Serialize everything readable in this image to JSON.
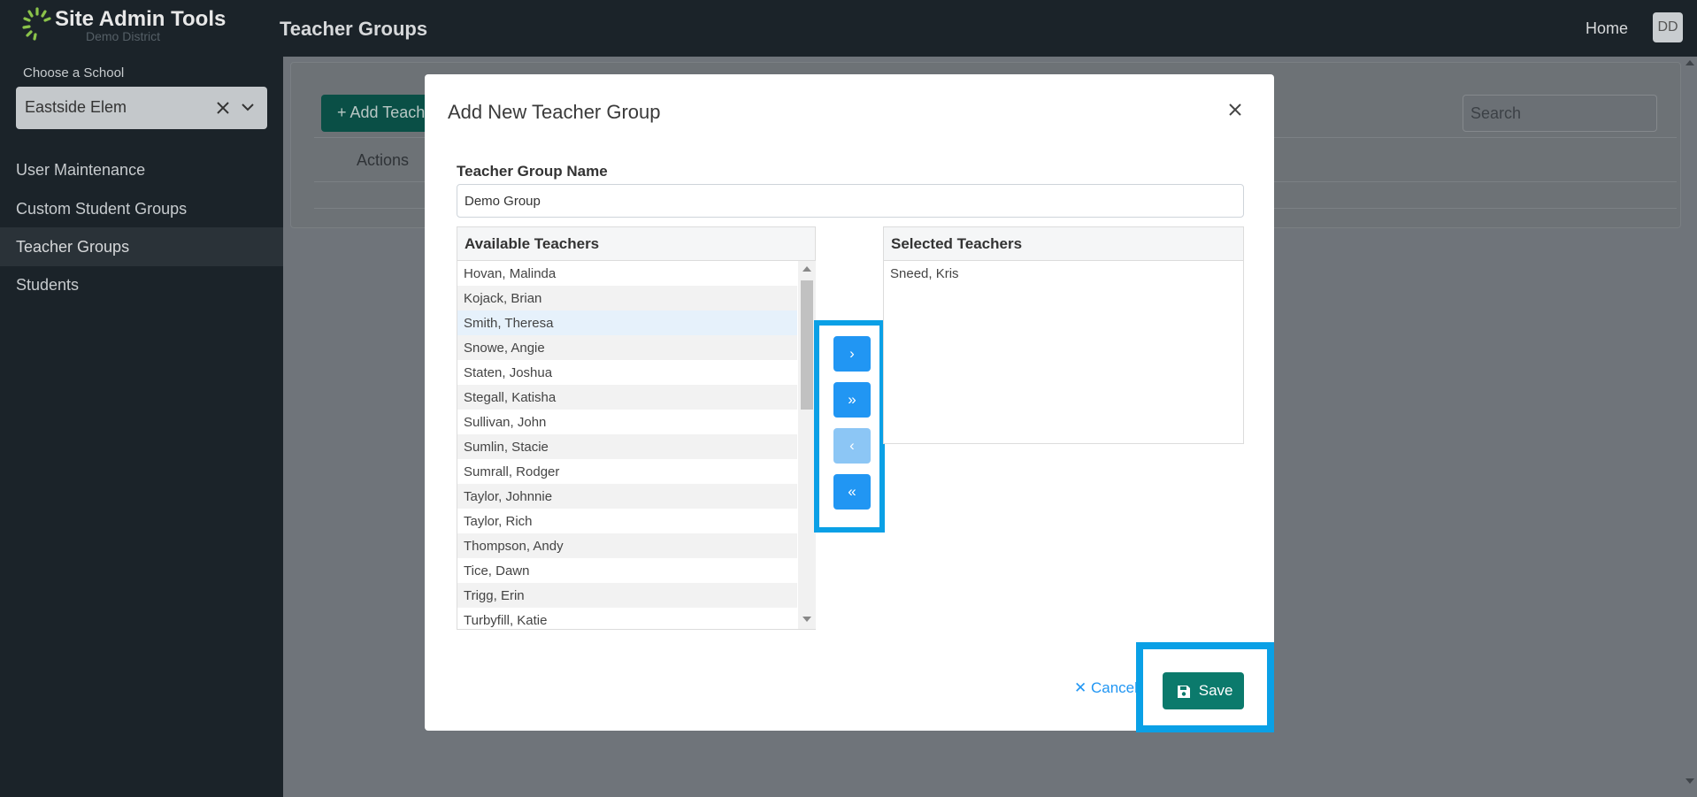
{
  "app": {
    "title": "Site Admin Tools",
    "subtitle": "Demo District"
  },
  "header": {
    "page_title": "Teacher Groups",
    "home_link": "Home",
    "avatar_initials": "DD"
  },
  "sidebar": {
    "school_label": "Choose a School",
    "school_value": "Eastside Elem",
    "items": [
      {
        "label": "User Maintenance",
        "active": false
      },
      {
        "label": "Custom Student Groups",
        "active": false
      },
      {
        "label": "Teacher Groups",
        "active": true
      },
      {
        "label": "Students",
        "active": false
      }
    ]
  },
  "background_page": {
    "add_button_label": "+ Add Teache",
    "search_placeholder": "Search",
    "actions_header": "Actions"
  },
  "modal": {
    "title": "Add New Teacher Group",
    "group_name_label": "Teacher Group Name",
    "group_name_value": "Demo Group",
    "available_header": "Available Teachers",
    "available_teachers": [
      "Hovan, Malinda",
      "Kojack, Brian",
      "Smith, Theresa",
      "Snowe, Angie",
      "Staten, Joshua",
      "Stegall, Katisha",
      "Sullivan, John",
      "Sumlin, Stacie",
      "Sumrall, Rodger",
      "Taylor, Johnnie",
      "Taylor, Rich",
      "Thompson, Andy",
      "Tice, Dawn",
      "Trigg, Erin",
      "Turbyfill, Katie"
    ],
    "selected_header": "Selected Teachers",
    "selected_teachers": [
      "Sneed, Kris"
    ],
    "move_buttons": {
      "move_right": "›",
      "move_all_right": "»",
      "move_left": "‹",
      "move_all_left": "«"
    },
    "cancel_label": "✕ Cancel",
    "save_label": "Save"
  },
  "colors": {
    "highlight_frame": "#0aa0e6",
    "save_button": "#0b7a6c",
    "move_button": "#2196f3",
    "sidebar_bg": "#1b2329"
  }
}
